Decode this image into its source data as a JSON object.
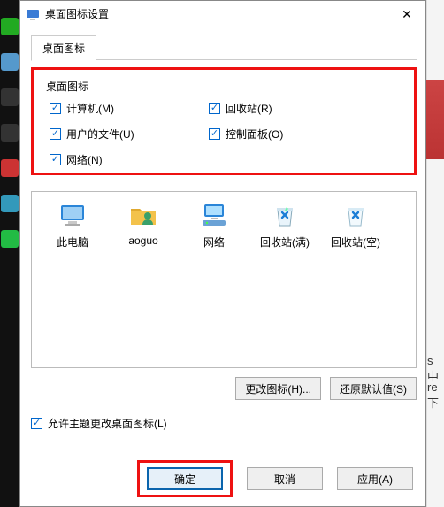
{
  "window": {
    "title": "桌面图标设置"
  },
  "tab": {
    "label": "桌面图标"
  },
  "group": {
    "title": "桌面图标",
    "items": [
      {
        "label": "计算机(M)",
        "checked": true
      },
      {
        "label": "回收站(R)",
        "checked": true
      },
      {
        "label": "用户的文件(U)",
        "checked": true
      },
      {
        "label": "控制面板(O)",
        "checked": true
      },
      {
        "label": "网络(N)",
        "checked": true
      }
    ]
  },
  "previews": [
    {
      "label": "此电脑",
      "icon": "pc"
    },
    {
      "label": "aoguo",
      "icon": "userfolder"
    },
    {
      "label": "网络",
      "icon": "network"
    },
    {
      "label": "回收站(满)",
      "icon": "recycle-full"
    },
    {
      "label": "回收站(空)",
      "icon": "recycle-empty"
    }
  ],
  "buttons": {
    "change_icon": "更改图标(H)...",
    "restore_default": "还原默认值(S)",
    "ok": "确定",
    "cancel": "取消",
    "apply": "应用(A)"
  },
  "allow_theme": {
    "label": "允许主题更改桌面图标(L)",
    "checked": true
  },
  "right": {
    "t1": "s 中",
    "t2": "re 下"
  }
}
